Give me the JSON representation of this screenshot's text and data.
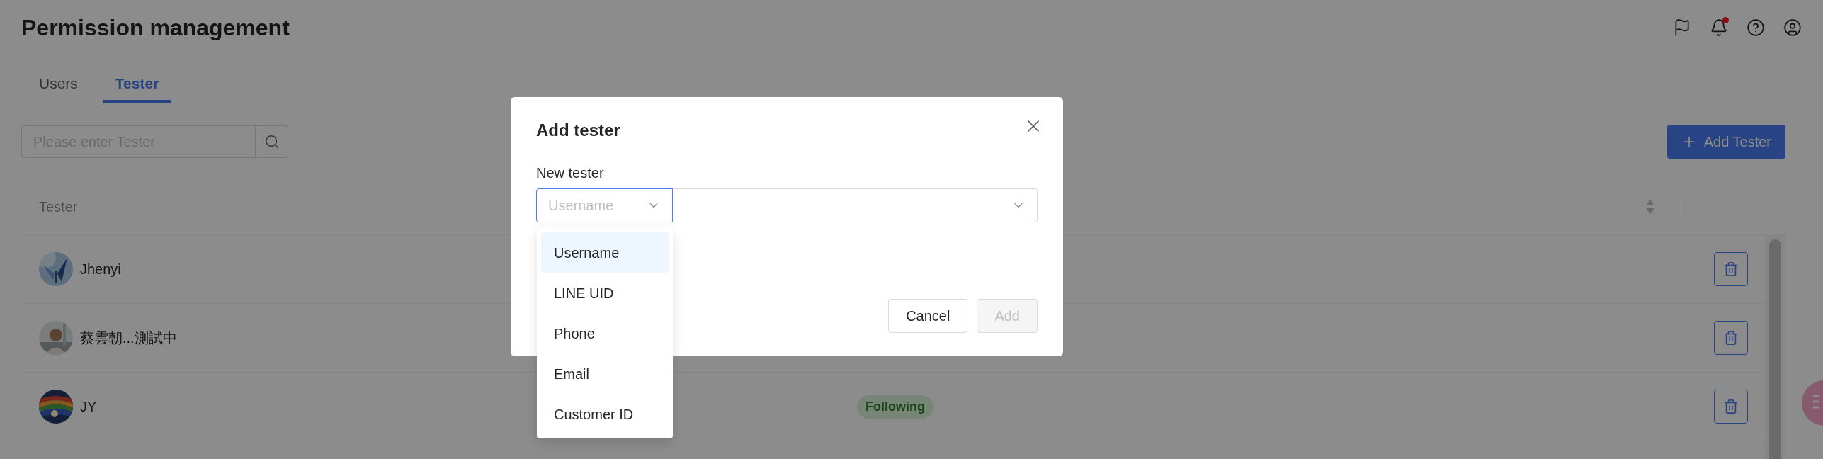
{
  "header": {
    "title": "Permission management",
    "notifications": {
      "unread": true
    }
  },
  "tabs": [
    {
      "label": "Users",
      "selected": false
    },
    {
      "label": "Tester",
      "selected": true
    }
  ],
  "search": {
    "placeholder": "Please enter Tester"
  },
  "add_button": {
    "label": "Add Tester"
  },
  "table": {
    "columns": [
      "Tester"
    ],
    "rows": [
      {
        "name": "Jhenyi"
      },
      {
        "name": "蔡雲朝...測試中"
      },
      {
        "name": "JY",
        "status": "Following"
      }
    ]
  },
  "dialog": {
    "title": "Add tester",
    "field_label": "New tester",
    "type_select": {
      "placeholder": "Username",
      "focused": true,
      "open": true
    },
    "options": [
      {
        "label": "Username",
        "selected": true
      },
      {
        "label": "LINE UID",
        "selected": false
      },
      {
        "label": "Phone",
        "selected": false
      },
      {
        "label": "Email",
        "selected": false
      },
      {
        "label": "Customer ID",
        "selected": false
      }
    ],
    "buttons": [
      {
        "label": "Cancel",
        "disabled": false
      },
      {
        "label": "Add",
        "disabled": true
      }
    ]
  }
}
